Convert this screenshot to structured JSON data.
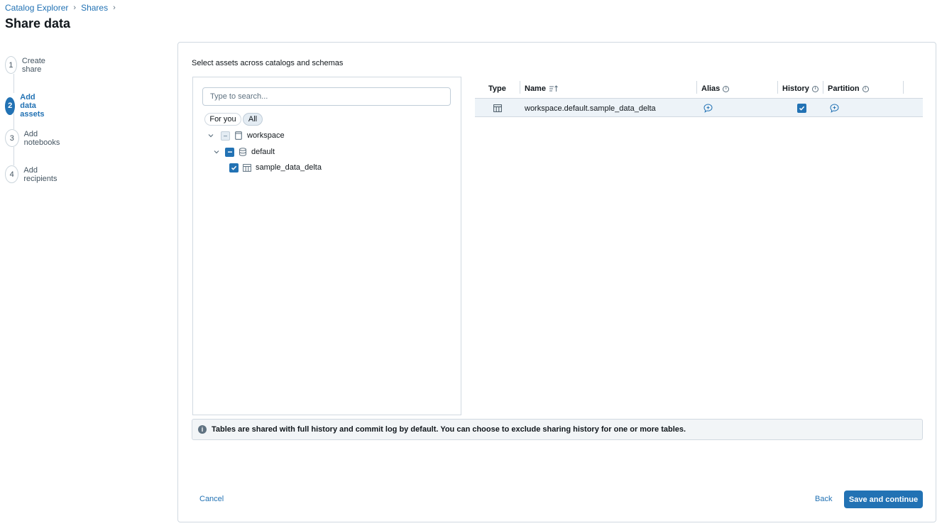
{
  "breadcrumb": {
    "items": [
      "Catalog Explorer",
      "Shares"
    ],
    "separator": "›"
  },
  "page_title": "Share data",
  "steps": [
    {
      "num": "1",
      "label": "Create share",
      "active": false
    },
    {
      "num": "2",
      "label": "Add data assets",
      "active": true
    },
    {
      "num": "3",
      "label": "Add notebooks",
      "active": false
    },
    {
      "num": "4",
      "label": "Add recipients",
      "active": false
    }
  ],
  "card": {
    "subtitle": "Select assets across catalogs and schemas",
    "search_placeholder": "Type to search...",
    "filters": [
      {
        "label": "For you",
        "selected": false
      },
      {
        "label": "All",
        "selected": true
      }
    ],
    "tree": [
      {
        "label": "workspace",
        "icon": "catalog-icon",
        "state": "indeterminate-light",
        "expanded": true
      },
      {
        "label": "default",
        "icon": "schema-icon",
        "state": "indeterminate",
        "expanded": true
      },
      {
        "label": "sample_data_delta",
        "icon": "table-icon",
        "state": "checked"
      }
    ],
    "grid": {
      "columns": {
        "type": "Type",
        "name": "Name",
        "alias": "Alias",
        "history": "History",
        "partition": "Partition"
      },
      "sort_icon": "sort-ascending-icon",
      "rows": [
        {
          "type_icon": "table-icon",
          "name": "workspace.default.sample_data_delta",
          "history": true
        }
      ]
    },
    "banner": "Tables are shared with full history and commit log by default. You can choose to exclude sharing history for one or more tables.",
    "actions": {
      "cancel": "Cancel",
      "back": "Back",
      "save": "Save and continue"
    }
  },
  "colors": {
    "accent": "#2272b4",
    "selected_row": "#edf3f8",
    "border": "#d1d9e1"
  }
}
